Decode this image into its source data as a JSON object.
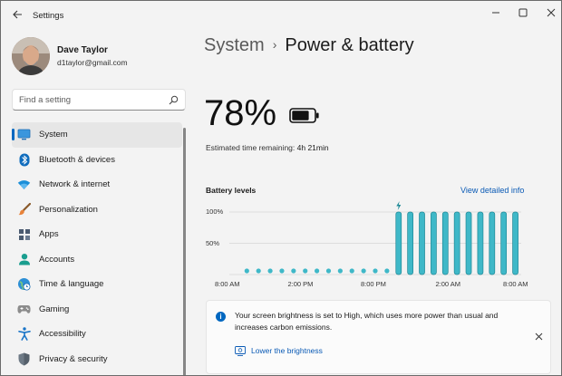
{
  "window": {
    "title": "Settings"
  },
  "profile": {
    "name": "Dave Taylor",
    "email": "d1taylor@gmail.com"
  },
  "search": {
    "placeholder": "Find a setting"
  },
  "sidebar": {
    "items": [
      {
        "label": "System",
        "icon": "monitor-icon",
        "selected": true
      },
      {
        "label": "Bluetooth & devices",
        "icon": "bluetooth-icon"
      },
      {
        "label": "Network & internet",
        "icon": "wifi-icon"
      },
      {
        "label": "Personalization",
        "icon": "brush-icon"
      },
      {
        "label": "Apps",
        "icon": "apps-icon"
      },
      {
        "label": "Accounts",
        "icon": "person-icon"
      },
      {
        "label": "Time & language",
        "icon": "clock-globe-icon"
      },
      {
        "label": "Gaming",
        "icon": "gamepad-icon"
      },
      {
        "label": "Accessibility",
        "icon": "accessibility-icon"
      },
      {
        "label": "Privacy & security",
        "icon": "shield-icon"
      }
    ]
  },
  "breadcrumb": {
    "parent": "System",
    "separator": "›",
    "current": "Power & battery"
  },
  "battery": {
    "percent_label": "78%",
    "level": 0.78,
    "estimate_label": "Estimated time remaining:",
    "estimate_value": "4h 21min"
  },
  "levels": {
    "title": "Battery levels",
    "detail_link": "View detailed info"
  },
  "chart_data": {
    "type": "bar",
    "y_ticks": [
      "100%",
      "50%"
    ],
    "x_ticks": [
      "8:00 AM",
      "2:00 PM",
      "8:00 PM",
      "2:00 AM",
      "8:00 AM"
    ],
    "ylim": [
      0,
      100
    ],
    "slots": 25,
    "values": [
      null,
      0,
      0,
      0,
      0,
      0,
      0,
      0,
      0,
      0,
      0,
      0,
      0,
      0,
      100,
      100,
      100,
      100,
      100,
      100,
      100,
      100,
      100,
      100,
      100
    ],
    "charging_marker_index": 14,
    "accent": "#3fb8c8",
    "accent_dark": "#1d8896"
  },
  "notice": {
    "text": "Your screen brightness is set to High, which uses more power than usual and increases carbon emissions.",
    "action": "Lower the brightness"
  }
}
